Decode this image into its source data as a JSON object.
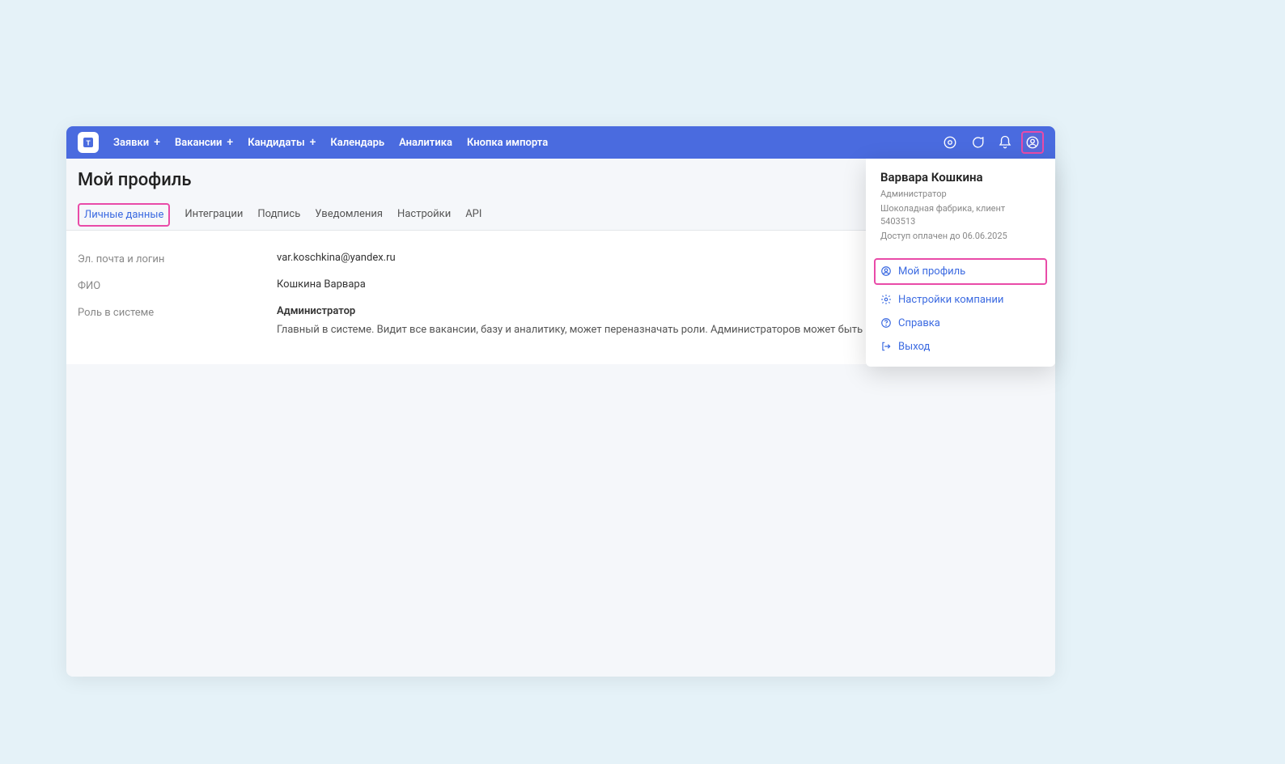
{
  "nav": {
    "items": [
      {
        "label": "Заявки",
        "has_plus": true
      },
      {
        "label": "Вакансии",
        "has_plus": true
      },
      {
        "label": "Кандидаты",
        "has_plus": true
      },
      {
        "label": "Календарь",
        "has_plus": false
      },
      {
        "label": "Аналитика",
        "has_plus": false
      },
      {
        "label": "Кнопка импорта",
        "has_plus": false
      }
    ]
  },
  "page": {
    "title": "Мой профиль"
  },
  "tabs": [
    {
      "label": "Личные данные",
      "active": true
    },
    {
      "label": "Интеграции",
      "active": false
    },
    {
      "label": "Подпись",
      "active": false
    },
    {
      "label": "Уведомления",
      "active": false
    },
    {
      "label": "Настройки",
      "active": false
    },
    {
      "label": "API",
      "active": false
    }
  ],
  "profile": {
    "email_label": "Эл. почта и логин",
    "email_value": "var.koschkina@yandex.ru",
    "fio_label": "ФИО",
    "fio_value": "Кошкина Варвара",
    "role_label": "Роль в системе",
    "role_value": "Администратор",
    "role_desc": "Главный в системе. Видит все вакансии, базу и аналитику, может переназначать роли. Администраторов может быть несколько."
  },
  "popover": {
    "name": "Варвара Кошкина",
    "role": "Администратор",
    "company": "Шоколадная фабрика, клиент 5403513",
    "access": "Доступ оплачен до 06.06.2025",
    "items": {
      "my_profile": "Мой профиль",
      "company_settings": "Настройки компании",
      "help": "Справка",
      "logout": "Выход"
    }
  }
}
